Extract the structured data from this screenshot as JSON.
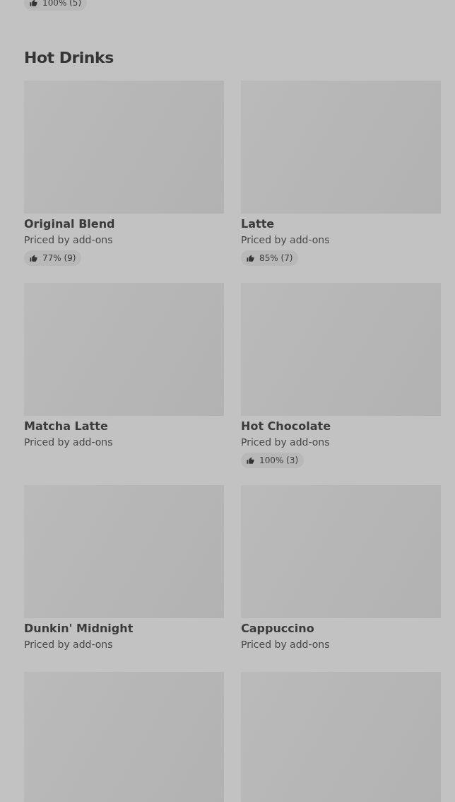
{
  "previous_item_rating": "100% (5)",
  "section": {
    "title": "Hot Drinks",
    "items": [
      {
        "kind": "full",
        "name": "Original Blend",
        "subtitle": "Priced by add-ons",
        "rating": "77% (9)"
      },
      {
        "kind": "full",
        "name": "Latte",
        "subtitle": "Priced by add-ons",
        "rating": "85% (7)"
      },
      {
        "kind": "full",
        "name": "Matcha Latte",
        "subtitle": "Priced by add-ons"
      },
      {
        "kind": "full",
        "name": "Hot Chocolate",
        "subtitle": "Priced by add-ons",
        "rating": "100% (3)"
      },
      {
        "kind": "full",
        "name": "Dunkin' Midnight",
        "subtitle": "Priced by add-ons"
      },
      {
        "kind": "full",
        "name": "Cappuccino",
        "subtitle": "Priced by add-ons"
      },
      {
        "kind": "cut"
      },
      {
        "kind": "cut"
      }
    ]
  }
}
